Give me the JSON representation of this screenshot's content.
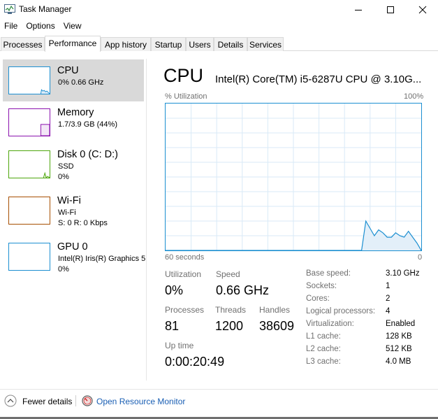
{
  "window": {
    "title": "Task Manager"
  },
  "menu": [
    "File",
    "Options",
    "View"
  ],
  "tabs": [
    "Processes",
    "Performance",
    "App history",
    "Startup",
    "Users",
    "Details",
    "Services"
  ],
  "active_tab": "Performance",
  "resources": {
    "cpu": {
      "name": "CPU",
      "line1": "0%  0.66 GHz",
      "color": "#1c8fd1"
    },
    "memory": {
      "name": "Memory",
      "line1": "1.7/3.9 GB (44%)",
      "color": "#8b12ae"
    },
    "disk": {
      "name": "Disk 0 (C: D:)",
      "line1": "SSD",
      "line2": "0%",
      "color": "#4da60c"
    },
    "wifi": {
      "name": "Wi-Fi",
      "line1": "Wi-Fi",
      "line2": "S: 0  R: 0 Kbps",
      "color": "#a74f01"
    },
    "gpu": {
      "name": "GPU 0",
      "line1": "Intel(R) Iris(R) Graphics 5",
      "line2": "0%",
      "color": "#1c8fd1"
    }
  },
  "main": {
    "title": "CPU",
    "model": "Intel(R) Core(TM) i5-6287U CPU @ 3.10G...",
    "y_label": "% Utilization",
    "y_max_label": "100%",
    "x_left_label": "60 seconds",
    "x_right_label": "0"
  },
  "chart_data": {
    "type": "area",
    "x": [
      60,
      14,
      13,
      12,
      11,
      10,
      9,
      8,
      7,
      6,
      5,
      4,
      3,
      2,
      1,
      0
    ],
    "values": [
      0,
      0,
      20,
      15,
      10,
      14,
      12,
      9,
      9,
      12,
      10,
      9,
      13,
      9,
      5,
      0
    ],
    "xlim": [
      60,
      0
    ],
    "ylim": [
      0,
      100
    ],
    "grid": true,
    "color": "#1c8fd1",
    "ylabel": "% Utilization",
    "xlabel": "60 seconds"
  },
  "stats": {
    "utilization_label": "Utilization",
    "utilization": "0%",
    "speed_label": "Speed",
    "speed": "0.66 GHz",
    "processes_label": "Processes",
    "processes": "81",
    "threads_label": "Threads",
    "threads": "1200",
    "handles_label": "Handles",
    "handles": "38609",
    "uptime_label": "Up time",
    "uptime": "0:00:20:49"
  },
  "specs": [
    {
      "label": "Base speed:",
      "value": "3.10 GHz"
    },
    {
      "label": "Sockets:",
      "value": "1"
    },
    {
      "label": "Cores:",
      "value": "2"
    },
    {
      "label": "Logical processors:",
      "value": "4"
    },
    {
      "label": "Virtualization:",
      "value": "Enabled"
    },
    {
      "label": "L1 cache:",
      "value": "128 KB"
    },
    {
      "label": "L2 cache:",
      "value": "512 KB"
    },
    {
      "label": "L3 cache:",
      "value": "4.0 MB"
    }
  ],
  "footer": {
    "fewer_details": "Fewer details",
    "resource_monitor": "Open Resource Monitor"
  }
}
